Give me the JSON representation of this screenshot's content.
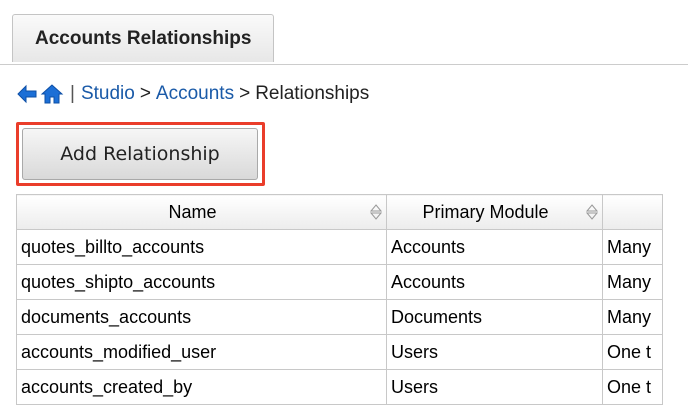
{
  "header": {
    "tab_label": "Accounts Relationships"
  },
  "icons": {
    "back": "back-arrow-icon",
    "home": "home-icon",
    "sort": "sort-icon"
  },
  "breadcrumb": {
    "separator": "|",
    "items": [
      "Studio",
      "Accounts",
      "Relationships"
    ],
    "arrow": ">"
  },
  "toolbar": {
    "add_label": "Add Relationship"
  },
  "table": {
    "columns": [
      "Name",
      "Primary Module",
      ""
    ],
    "rows": [
      [
        "quotes_billto_accounts",
        "Accounts",
        "Many"
      ],
      [
        "quotes_shipto_accounts",
        "Accounts",
        "Many"
      ],
      [
        "documents_accounts",
        "Documents",
        "Many"
      ],
      [
        "accounts_modified_user",
        "Users",
        "One t"
      ],
      [
        "accounts_created_by",
        "Users",
        "One t"
      ]
    ]
  },
  "colors": {
    "link": "#1a5aa8",
    "highlight": "#ea3d2a",
    "back_arrow": "#1c6fd6"
  }
}
